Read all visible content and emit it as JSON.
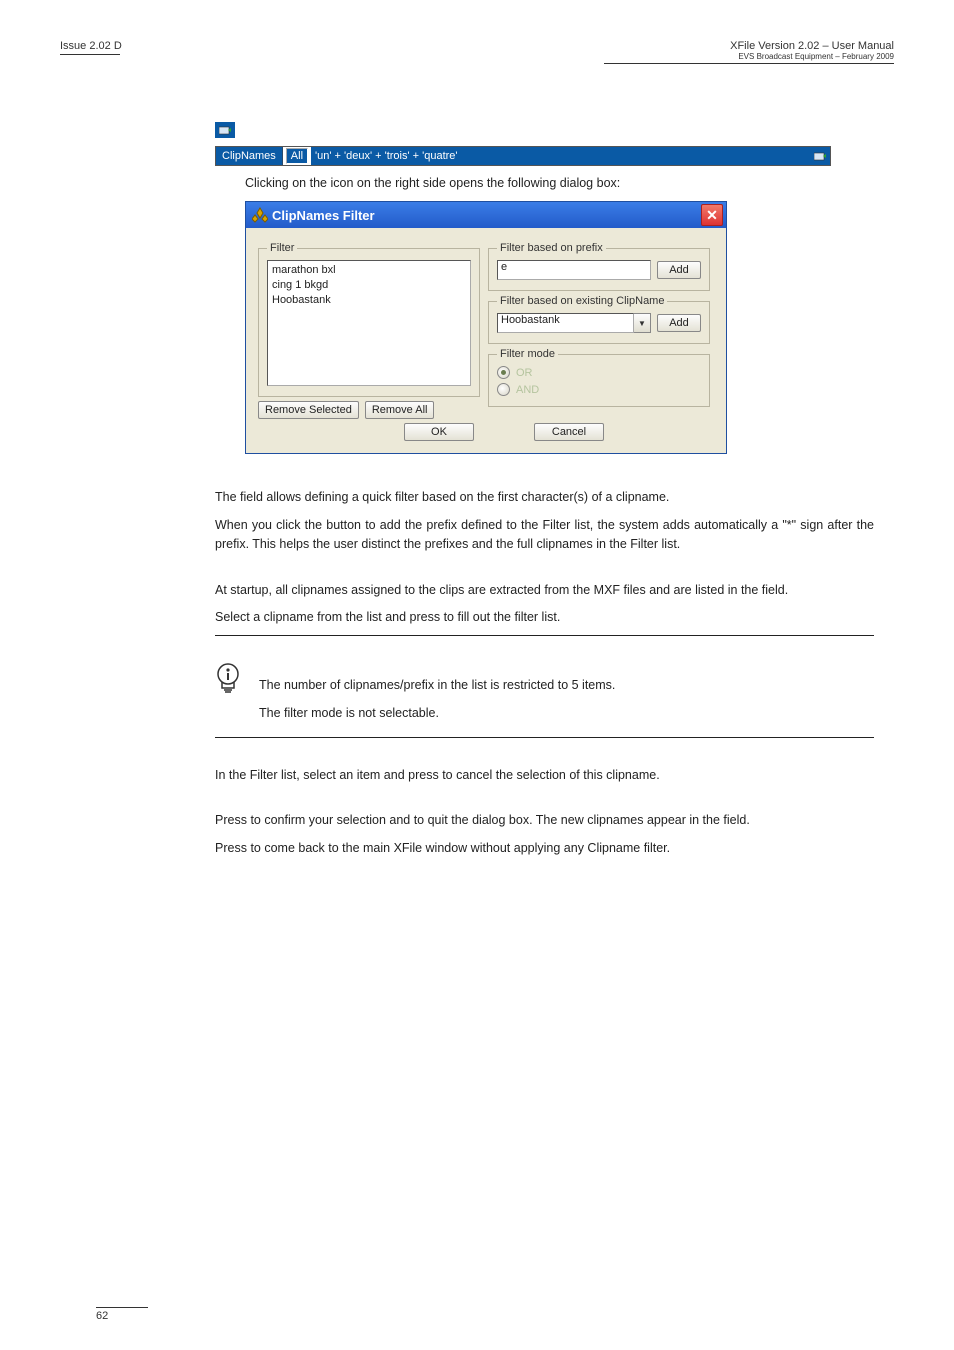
{
  "header": {
    "issue": "Issue 2.02 D",
    "title": "XFile Version 2.02 – User Manual",
    "subtitle": "EVS Broadcast Equipment – February 2009"
  },
  "statusbar": {
    "clipnames": "ClipNames",
    "all": "All",
    "summary": "'un' + 'deux' + 'trois' + 'quatre'"
  },
  "intro_line": "Clicking on the icon on the right side opens the following dialog box:",
  "dialog": {
    "title": "ClipNames Filter",
    "filter_legend": "Filter",
    "filter_items": [
      "marathon bxl",
      "cing 1 bkgd",
      "Hoobastank"
    ],
    "remove_selected": "Remove Selected",
    "remove_all": "Remove All",
    "prefix_legend": "Filter based on prefix",
    "prefix_value": "e",
    "add1": "Add",
    "exist_legend": "Filter based on existing ClipName",
    "exist_value": "Hoobastank",
    "add2": "Add",
    "mode_legend": "Filter mode",
    "mode_or": "OR",
    "mode_and": "AND",
    "ok": "OK",
    "cancel": "Cancel"
  },
  "body": {
    "p1_a": "The ",
    "p1_b": " field allows defining a quick filter based on the first character(s) of a clipname.",
    "p2_a": "When you click the ",
    "p2_b": " button to add the prefix defined to the Filter list, the system adds automatically a \"*\" sign after the prefix. This helps the user distinct the prefixes and the full clipnames in the Filter list.",
    "p3_a": "At startup, all clipnames assigned to the clips are extracted from the MXF files and are listed in the ",
    "p3_b": " field.",
    "p4_a": "Select a clipname from the list and press ",
    "p4_b": " to fill out the filter list.",
    "note1": "The number of clipnames/prefix in the list is restricted to 5 items.",
    "note2": "The filter mode is not selectable.",
    "p5_a": "In the Filter list, select an item and press ",
    "p5_b": " to cancel the selection of this clipname.",
    "p6_a": "Press ",
    "p6_b": " to confirm your selection and to quit the dialog box. The new clipnames appear in the ",
    "p6_c": " field.",
    "p7_a": "Press ",
    "p7_b": " to come back to the main XFile window without applying any Clipname filter."
  },
  "footer": {
    "page": "62"
  }
}
